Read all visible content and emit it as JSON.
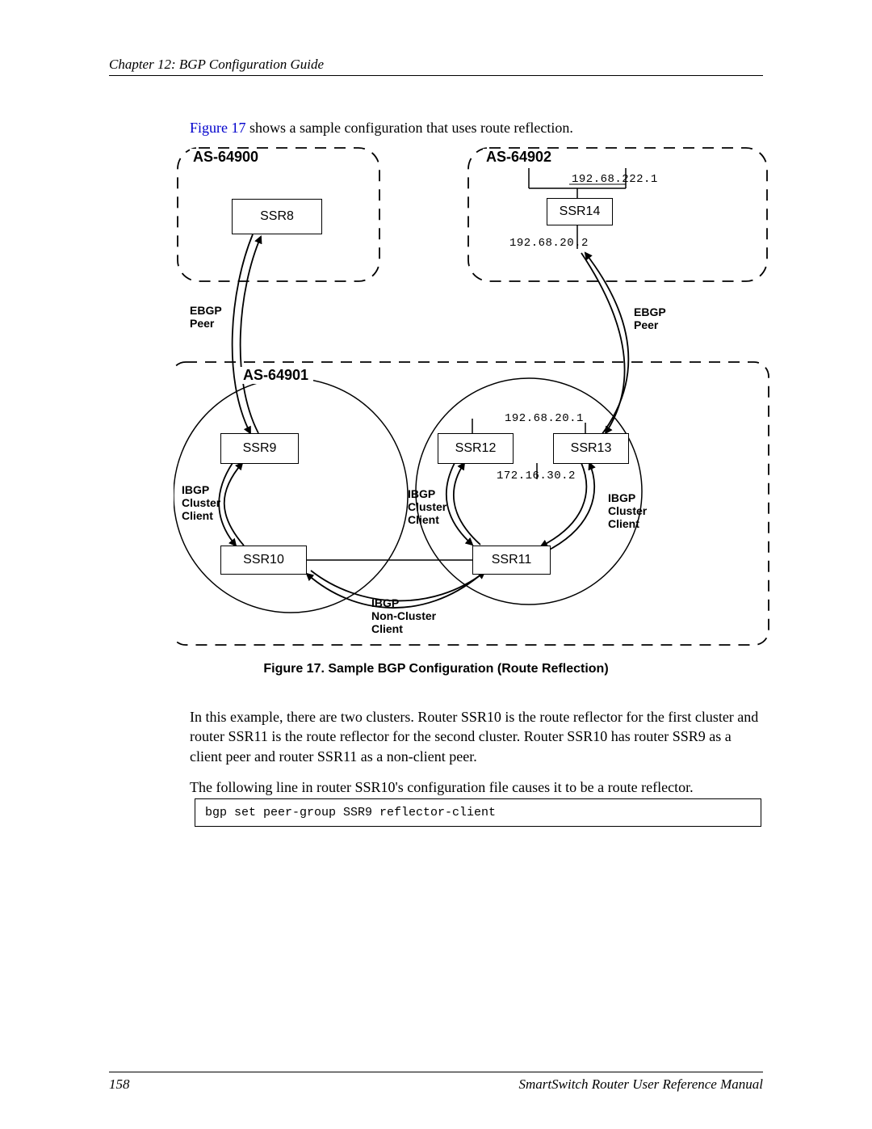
{
  "chapter": "Chapter 12: BGP Configuration Guide",
  "intro_ref": "Figure 17",
  "intro_rest": " shows a sample configuration that uses route reflection.",
  "diagram": {
    "as64900": "AS-64900",
    "as64901": "AS-64901",
    "as64902": "AS-64902",
    "ssr8": "SSR8",
    "ssr9": "SSR9",
    "ssr10": "SSR10",
    "ssr11": "SSR11",
    "ssr12": "SSR12",
    "ssr13": "SSR13",
    "ssr14": "SSR14",
    "ip_222_1": "192.68.222.1",
    "ip_20_2": "192.68.20.2",
    "ip_20_1": "192.68.20.1",
    "ip_30_2": "172.16.30.2",
    "ebgp_left": "EBGP\nPeer",
    "ebgp_right": "EBGP\nPeer",
    "ibgp_cc_left": "IBGP\nCluster\nClient",
    "ibgp_cc_mid": "IBGP\nCluster\nClient",
    "ibgp_cc_right": "IBGP\nCluster\nClient",
    "ibgp_nc": "IBGP\nNon-Cluster\nClient"
  },
  "caption": "Figure 17. Sample BGP Configuration (Route Reflection)",
  "para1": "In this example, there are two clusters. Router SSR10 is the route reflector for the first cluster and router SSR11 is the route reflector for the second cluster. Router SSR10 has router SSR9 as a client peer and router SSR11 as a non-client peer.",
  "para2": "The following line in router SSR10's configuration file causes it to be a route reflector.",
  "code": "bgp set peer-group SSR9 reflector-client",
  "page_number": "158",
  "footer_title": "SmartSwitch Router User Reference Manual"
}
